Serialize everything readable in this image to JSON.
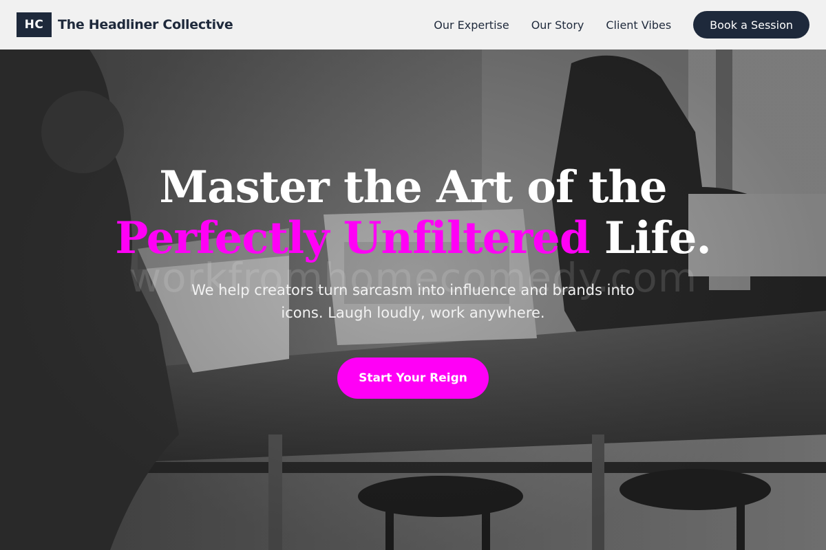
{
  "header": {
    "logo_text": "HC",
    "brand_name": "The Headliner Collective",
    "nav": [
      "Our Expertise",
      "Our Story",
      "Client Vibes"
    ],
    "cta": "Book a Session"
  },
  "hero": {
    "headline_line1": "Master the Art of the",
    "headline_accent": "Perfectly Unfiltered",
    "headline_line2_end": " Life.",
    "subhead": "We help creators turn sarcasm into influence and brands into icons. Laugh loudly, work anywhere.",
    "cta": "Start Your Reign",
    "watermark": "workfromhomecomedy.com"
  },
  "colors": {
    "brand_dark": "#1e293b",
    "accent_magenta": "#ff00f6",
    "header_bg": "#f1f1f1"
  }
}
